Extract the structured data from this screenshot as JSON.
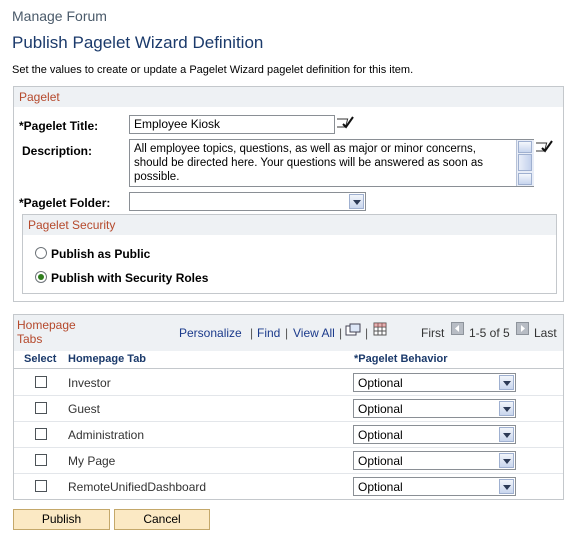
{
  "header": {
    "breadcrumb": "Manage Forum",
    "title": "Publish Pagelet Wizard Definition",
    "instructions": "Set the values to create or update a Pagelet Wizard pagelet definition for this item."
  },
  "pagelet": {
    "section_title": "Pagelet",
    "title_label": "*Pagelet Title:",
    "title_value": "Employee Kiosk",
    "description_label": "Description:",
    "description_value": "All employee topics, questions, as well as major or minor concerns, should be directed here.  Your questions will be answered as soon as possible.",
    "folder_label": "*Pagelet Folder:",
    "folder_value": ""
  },
  "security": {
    "section_title": "Pagelet Security",
    "option_public": "Publish as Public",
    "option_roles": "Publish with Security Roles",
    "selected": "roles"
  },
  "homepage_tabs": {
    "title_line1": "Homepage",
    "title_line2": "Tabs",
    "personalize": "Personalize",
    "find": "Find",
    "view_all": "View All",
    "first": "First",
    "range": "1-5 of 5",
    "last": "Last",
    "col_select": "Select",
    "col_tab": "Homepage Tab",
    "col_behavior": "*Pagelet Behavior",
    "rows": [
      {
        "tab": "Investor",
        "behavior": "Optional",
        "selected": false
      },
      {
        "tab": "Guest",
        "behavior": "Optional",
        "selected": false
      },
      {
        "tab": "Administration",
        "behavior": "Optional",
        "selected": false
      },
      {
        "tab": "My Page",
        "behavior": "Optional",
        "selected": false
      },
      {
        "tab": "RemoteUnifiedDashboard",
        "behavior": "Optional",
        "selected": false
      }
    ]
  },
  "buttons": {
    "publish": "Publish",
    "cancel": "Cancel"
  }
}
